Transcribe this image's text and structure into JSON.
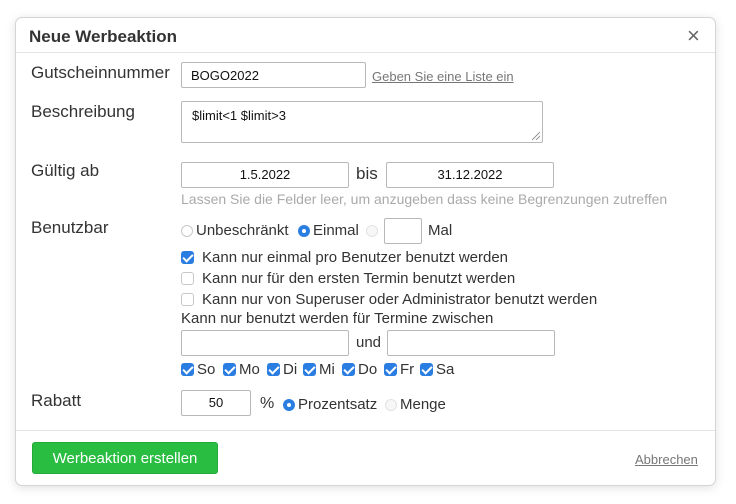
{
  "dialog": {
    "title": "Neue Werbeaktion",
    "close_icon": "×"
  },
  "coupon": {
    "label": "Gutscheinnummer",
    "value": "BOGO2022",
    "list_link": "Geben Sie eine Liste ein"
  },
  "description": {
    "label": "Beschreibung",
    "value": "$limit<1 $limit>3"
  },
  "validity": {
    "label": "Gültig ab",
    "from": "1.5.2022",
    "bis": "bis",
    "to": "31.12.2022",
    "hint": "Lassen Sie die Felder leer, um anzugeben dass keine Begrenzungen zutreffen"
  },
  "usable": {
    "label": "Benutzbar",
    "radio_unlimited": "Unbeschränkt",
    "radio_once": "Einmal",
    "times_value": "",
    "times_label": "Mal",
    "selected": "Einmal",
    "checks": [
      {
        "label": "Kann nur einmal pro Benutzer benutzt werden",
        "checked": true
      },
      {
        "label": "Kann nur für den ersten Termin benutzt werden",
        "checked": false
      },
      {
        "label": "Kann nur von Superuser oder Administrator benutzt werden",
        "checked": false
      }
    ],
    "between_label": "Kann nur benutzt werden für Termine zwischen",
    "between_from": "",
    "und": "und",
    "between_to": "",
    "days": [
      {
        "label": "So",
        "checked": true
      },
      {
        "label": "Mo",
        "checked": true
      },
      {
        "label": "Di",
        "checked": true
      },
      {
        "label": "Mi",
        "checked": true
      },
      {
        "label": "Do",
        "checked": true
      },
      {
        "label": "Fr",
        "checked": true
      },
      {
        "label": "Sa",
        "checked": true
      }
    ]
  },
  "discount": {
    "label": "Rabatt",
    "value": "50",
    "percent_sign": "%",
    "radio_percent": "Prozentsatz",
    "radio_amount": "Menge",
    "selected": "Prozentsatz"
  },
  "footer": {
    "create_button": "Werbeaktion erstellen",
    "cancel_link": "Abbrechen"
  },
  "colors": {
    "accent": "#2a7de1",
    "button": "#29bd41"
  }
}
